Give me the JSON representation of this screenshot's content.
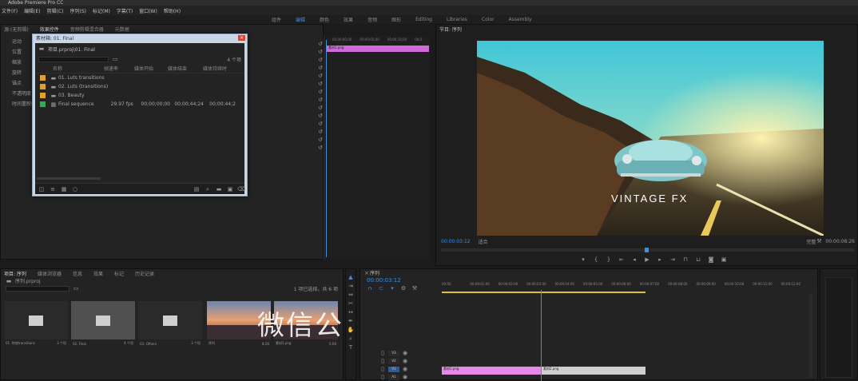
{
  "window": {
    "title": "Adobe Premiere Pro CC"
  },
  "menu": [
    "文件(F)",
    "编辑(E)",
    "剪辑(C)",
    "序列(S)",
    "标记(M)",
    "字幕(T)",
    "窗口(W)",
    "帮助(H)"
  ],
  "workspaces": [
    "组件",
    "编辑",
    "颜色",
    "效果",
    "音频",
    "图形",
    "Editing",
    "Libraries",
    "Color",
    "Assembly"
  ],
  "source_panel": {
    "tabs": [
      "源:(无剪辑)",
      "效果控件",
      "音频剪辑混合器",
      "元数据"
    ],
    "items": [
      "运动",
      "位置",
      "缩放",
      "旋转",
      "锚点",
      "不透明度",
      "时间重映射"
    ]
  },
  "bin_popup": {
    "title": "素材箱: 01. Final",
    "path": "项目.prproj\\01. Final",
    "item_count": "4 个项",
    "columns": [
      "名称",
      "帧速率",
      "媒体开始",
      "媒体结束",
      "媒体持续时"
    ],
    "rows": [
      {
        "name": "01. Luts transitions",
        "fps": "",
        "start": "",
        "end": "",
        "dur": "",
        "color": "#e0a030",
        "kind": "folder"
      },
      {
        "name": "02. Luts (transitions) - 8",
        "fps": "",
        "start": "",
        "end": "",
        "dur": "",
        "color": "#e0a030",
        "kind": "folder"
      },
      {
        "name": "03. Beauty",
        "fps": "",
        "start": "",
        "end": "",
        "dur": "",
        "color": "#e0a030",
        "kind": "folder"
      },
      {
        "name": "Final sequence",
        "fps": "29.97 fps",
        "start": "00;00;00;00",
        "end": "00;00;44;24",
        "dur": "00;00;44;2",
        "color": "#3aa850",
        "kind": "sequence"
      }
    ]
  },
  "mini_timeline": {
    "times": [
      "00;00;00;00",
      "00;00;05;00",
      "00;00;10;00",
      "00;0"
    ],
    "clip": "素材1.png"
  },
  "program": {
    "title": "节目: 序列",
    "timecode": "00:00:03:12",
    "fit": "适合",
    "quality": "完整",
    "duration": "00:00:08:26",
    "overlay": "VINTAGE FX"
  },
  "project_panel": {
    "tabs": [
      "项目: 序列",
      "媒体浏览器",
      "信息",
      "效果",
      "标记",
      "历史记录"
    ],
    "path": "序列.prproj",
    "selection": "1 项已选择，共 6 项",
    "items": [
      {
        "name": "01. 特效transitions",
        "meta": "3 个项",
        "kind": "folder"
      },
      {
        "name": "02. Final",
        "meta": "4 个项",
        "kind": "folder"
      },
      {
        "name": "03. Others",
        "meta": "3 个项",
        "kind": "folder"
      },
      {
        "name": "序列",
        "meta": "8:26",
        "kind": "sunset"
      },
      {
        "name": "素材1.png",
        "meta": "5:00",
        "kind": "sunset"
      }
    ]
  },
  "timeline": {
    "title": "序列",
    "timecode": "00:00:03:12",
    "ruler": [
      "00:00",
      "00:00:01:00",
      "00:00:02:00",
      "00:00:03:00",
      "00:00:04:00",
      "00:00:05:00",
      "00:00:06:00",
      "00:00:07:00",
      "00:00:08:00",
      "00:00:09:00",
      "00:00:10:00",
      "00:00:11:00",
      "00:00:12:00"
    ],
    "clip1": "素材1.png",
    "clip2": "素材2.png",
    "tracks": [
      "V3",
      "V2",
      "V1",
      "A1"
    ]
  },
  "watermark": "微信公"
}
